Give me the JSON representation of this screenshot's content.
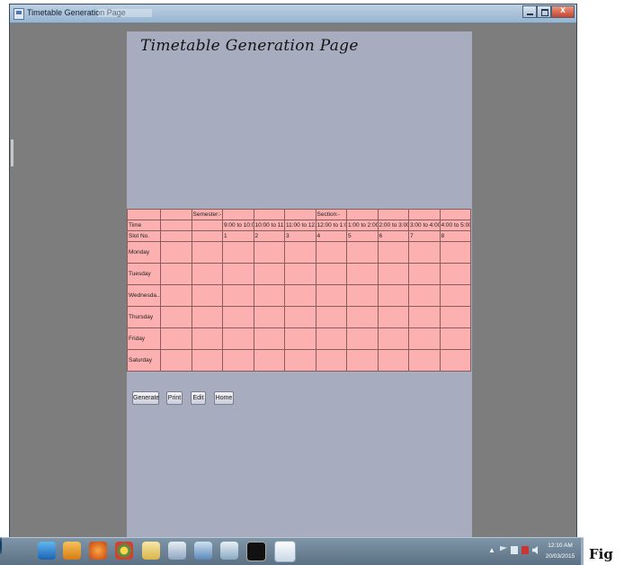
{
  "window": {
    "title": "Timetable Generation Page"
  },
  "page": {
    "heading": "Timetable Generation Page"
  },
  "timetable": {
    "header_row": [
      "",
      "",
      "Semester:-",
      "",
      "",
      "",
      "Section:-",
      "",
      "",
      "",
      ""
    ],
    "time_row": [
      "Time",
      "",
      "",
      "9:00 to 10:00",
      "10:00 to 11...",
      "11:00 to 12...",
      "12:00 to 1:00",
      "1:00 to 2:00",
      "2:00 to 3:00",
      "3:00 to 4:00",
      "4:00 to 5:00"
    ],
    "slot_row": [
      "Slot No.",
      "",
      "",
      "1",
      "2",
      "3",
      "4",
      "5",
      "6",
      "7",
      "8"
    ],
    "days": [
      "Monday",
      "Tuesday",
      "Wednesda...",
      "Thursday",
      "Friday",
      "Saturday"
    ]
  },
  "buttons": {
    "generate": "Generate",
    "print": "Print",
    "edit": "Edit",
    "home": "Home"
  },
  "taskbar": {
    "clock_time": "12:10 AM",
    "clock_date": "20/03/2015"
  },
  "caption": "Fig",
  "colors": {
    "panel": "#a8acbf",
    "grid": "#fdb0b0",
    "window_bg": "#7d7d7d"
  }
}
